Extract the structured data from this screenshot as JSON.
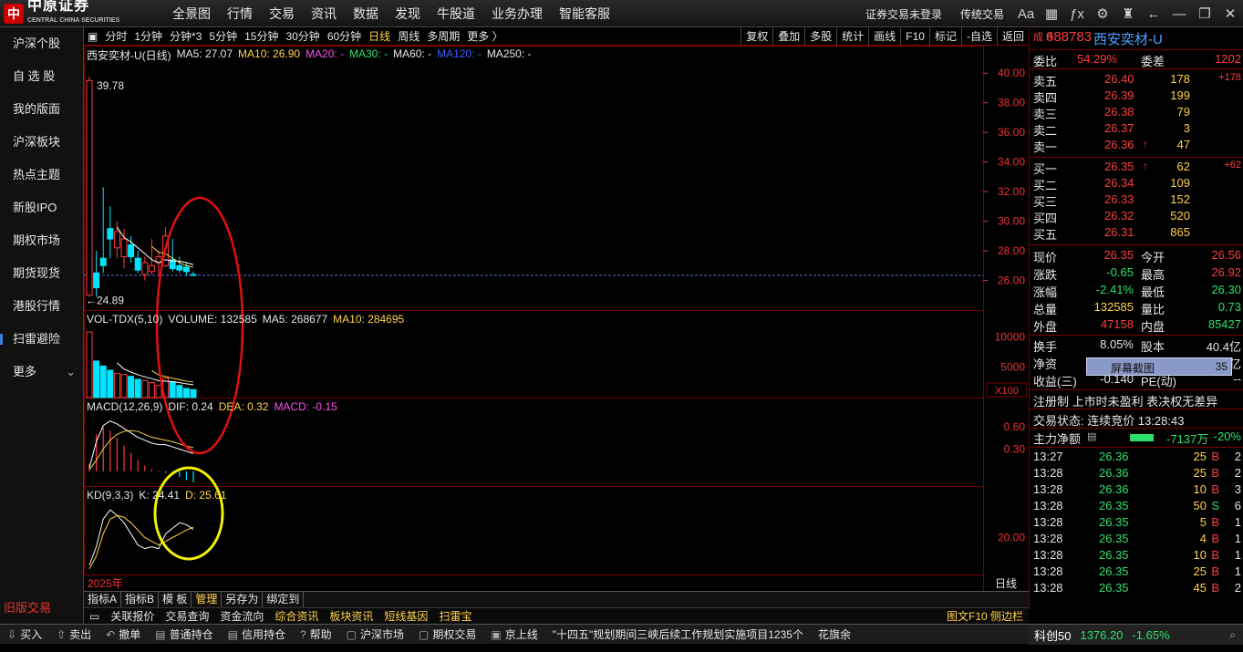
{
  "app": {
    "logo_text": "中原证券",
    "logo_sub": "CENTRAL CHINA SECURITIES",
    "menu": [
      "全景图",
      "行情",
      "交易",
      "资讯",
      "数据",
      "发现",
      "牛股道",
      "业务办理",
      "智能客服"
    ],
    "top_right": [
      "证券交易未登录",
      "传统交易"
    ],
    "top_icons": [
      "font-size-icon",
      "grid-icon",
      "formula-icon",
      "gear-icon",
      "shirt-icon",
      "back-icon",
      "minimize-icon",
      "restore-icon",
      "close-icon"
    ]
  },
  "sidebar": {
    "items": [
      "沪深个股",
      "自 选 股",
      "我的版面",
      "沪深板块",
      "热点主题",
      "新股IPO",
      "期权市场",
      "期货现货",
      "港股行情",
      "扫雷避险",
      "更多"
    ],
    "bottom": "旧版交易"
  },
  "periodbar": {
    "periods": [
      "分时",
      "1分钟",
      "分钟*3",
      "5分钟",
      "15分钟",
      "30分钟",
      "60分钟",
      "日线",
      "周线",
      "多周期",
      "更多 〉"
    ],
    "active": "日线",
    "right": [
      "复权",
      "叠加",
      "多股",
      "统计",
      "画线",
      "F10",
      "标记",
      "-自选",
      "返回"
    ]
  },
  "main_legend": {
    "name": "西安奕材-U(日线)",
    "ma5": "MA5: 27.07",
    "ma10": "MA10: 26.90",
    "ma20": "MA20: -",
    "ma30": "MA30: -",
    "ma60": "MA60: -",
    "ma120": "MA120: -",
    "ma250": "MA250: -",
    "high_label": "39.78",
    "low_label": "24.89"
  },
  "vol_legend": {
    "name": "VOL-TDX(5,10)",
    "volume": "VOLUME: 132585",
    "ma5": "MA5: 268677",
    "ma10": "MA10: 284695",
    "unit": "X100"
  },
  "macd_legend": {
    "name": "MACD(12,26,9)",
    "dif": "DIF: 0.24",
    "dea": "DEA: 0.32",
    "macd": "MACD: -0.15"
  },
  "kd_legend": {
    "name": "KD(9,3,3)",
    "k": "K: 24.41",
    "d": "D: 25.61"
  },
  "year_label": "2025年",
  "axis": {
    "price_ticks": [
      "40.00",
      "38.00",
      "36.00",
      "34.00",
      "32.00",
      "30.00",
      "28.00",
      "26.00"
    ],
    "vol_ticks": [
      "10000",
      "5000"
    ],
    "macd_ticks": [
      "0.60",
      "0.30"
    ],
    "kd_ticks": [
      "20.00"
    ],
    "period_button": "日线"
  },
  "chart_data": {
    "type": "candlestick",
    "price_range": [
      24,
      41
    ],
    "candles": [
      {
        "o": 25.0,
        "h": 39.78,
        "l": 24.89,
        "c": 39.5
      },
      {
        "o": 26.5,
        "h": 28.0,
        "l": 24.89,
        "c": 25.5
      },
      {
        "o": 27.5,
        "h": 32.3,
        "l": 26.5,
        "c": 27.0
      },
      {
        "o": 29.5,
        "h": 31.0,
        "l": 27.5,
        "c": 28.8
      },
      {
        "o": 28.2,
        "h": 30.0,
        "l": 27.5,
        "c": 29.3
      },
      {
        "o": 27.6,
        "h": 29.5,
        "l": 26.8,
        "c": 28.8
      },
      {
        "o": 28.4,
        "h": 29.0,
        "l": 27.2,
        "c": 27.6
      },
      {
        "o": 27.5,
        "h": 28.0,
        "l": 26.5,
        "c": 26.7
      },
      {
        "o": 26.4,
        "h": 27.6,
        "l": 26.0,
        "c": 27.2
      },
      {
        "o": 26.6,
        "h": 28.8,
        "l": 26.4,
        "c": 27.0
      },
      {
        "o": 27.2,
        "h": 28.0,
        "l": 26.3,
        "c": 27.6
      },
      {
        "o": 27.0,
        "h": 29.6,
        "l": 26.9,
        "c": 29.0
      },
      {
        "o": 27.4,
        "h": 28.8,
        "l": 26.6,
        "c": 26.8
      },
      {
        "o": 27.0,
        "h": 27.6,
        "l": 26.5,
        "c": 26.7
      },
      {
        "o": 26.9,
        "h": 27.2,
        "l": 26.3,
        "c": 26.6
      },
      {
        "o": 26.4,
        "h": 26.6,
        "l": 26.3,
        "c": 26.35
      }
    ],
    "volume": [
      10800,
      6000,
      5200,
      4500,
      4000,
      3800,
      3500,
      3000,
      2800,
      2500,
      2000,
      3200,
      2600,
      2000,
      1500,
      1326
    ],
    "macd_hist": [
      0.1,
      0.5,
      0.6,
      0.55,
      0.45,
      0.35,
      0.25,
      0.15,
      0.08,
      0.03,
      0.01,
      -0.02,
      -0.05,
      -0.08,
      -0.12,
      -0.15
    ],
    "dif": [
      0.05,
      0.4,
      0.62,
      0.68,
      0.64,
      0.58,
      0.52,
      0.46,
      0.42,
      0.38,
      0.36,
      0.36,
      0.33,
      0.3,
      0.27,
      0.24
    ],
    "dea": [
      0.02,
      0.15,
      0.3,
      0.42,
      0.5,
      0.54,
      0.55,
      0.54,
      0.5,
      0.46,
      0.44,
      0.42,
      0.4,
      0.37,
      0.34,
      0.32
    ],
    "k": [
      5,
      15,
      30,
      35,
      32,
      28,
      22,
      16,
      14,
      15,
      14,
      22,
      25,
      28,
      27,
      24.41
    ],
    "d": [
      3,
      10,
      22,
      30,
      32,
      31,
      28,
      24,
      20,
      18,
      16,
      18,
      20,
      22,
      24,
      25.61
    ],
    "ma5": [
      null,
      null,
      null,
      null,
      29.6,
      28.9,
      28.6,
      28.2,
      27.8,
      27.4,
      27.2,
      27.4,
      27.3,
      27.3,
      27.2,
      27.07
    ],
    "ma10": [
      null,
      null,
      null,
      null,
      null,
      null,
      null,
      null,
      null,
      28.3,
      27.9,
      27.8,
      27.5,
      27.2,
      27.0,
      26.9
    ],
    "last_price": 26.35
  },
  "quote": {
    "code": "688783",
    "name": "西安奕材-U",
    "badge": "成 R",
    "wb_label": "委比",
    "wb_value": "54.29%",
    "wc_label": "委差",
    "wc_value": "1202",
    "asks": [
      {
        "label": "卖五",
        "price": "26.40",
        "vol": "178",
        "chg": "+178"
      },
      {
        "label": "卖四",
        "price": "26.39",
        "vol": "199",
        "chg": ""
      },
      {
        "label": "卖三",
        "price": "26.38",
        "vol": "79",
        "chg": ""
      },
      {
        "label": "卖二",
        "price": "26.37",
        "vol": "3",
        "chg": ""
      },
      {
        "label": "卖一",
        "price": "26.36",
        "vol": "47",
        "chg": ""
      }
    ],
    "bids": [
      {
        "label": "买一",
        "price": "26.35",
        "vol": "62",
        "chg": "+62"
      },
      {
        "label": "买二",
        "price": "26.34",
        "vol": "109",
        "chg": ""
      },
      {
        "label": "买三",
        "price": "26.33",
        "vol": "152",
        "chg": ""
      },
      {
        "label": "买四",
        "price": "26.32",
        "vol": "520",
        "chg": ""
      },
      {
        "label": "买五",
        "price": "26.31",
        "vol": "865",
        "chg": ""
      }
    ],
    "stats": [
      {
        "l1": "现价",
        "v1": "26.35",
        "l2": "今开",
        "v2": "26.56"
      },
      {
        "l1": "涨跌",
        "v1": "-0.65",
        "l2": "最高",
        "v2": "26.92"
      },
      {
        "l1": "涨幅",
        "v1": "-2.41%",
        "l2": "最低",
        "v2": "26.30"
      },
      {
        "l1": "总量",
        "v1": "132585",
        "l2": "量比",
        "v2": "0.73"
      },
      {
        "l1": "外盘",
        "v1": "47158",
        "l2": "内盘",
        "v2": "85427"
      }
    ],
    "stats2": [
      {
        "l1": "换手",
        "v1": "8.05%",
        "l2": "股本",
        "v2": "40.4亿"
      },
      {
        "l1": "净资",
        "v1": "",
        "l2": "流通",
        "v2": "1.05亿"
      },
      {
        "l1": "收益(三)",
        "v1": "-0.140",
        "l2": "PE(动)",
        "v2": "--"
      }
    ],
    "popup_text": "屏幕截图",
    "popup_num": "35",
    "flags": "注册制 上市时未盈利 表决权无差异",
    "status": "交易状态: 连续竞价 13:28:43",
    "net_label": "主力净额",
    "net_value": "-7137万",
    "net_pct": "-20%",
    "ticks": [
      {
        "t": "13:27",
        "p": "26.36",
        "v": "25",
        "s": "B",
        "n": "2"
      },
      {
        "t": "13:28",
        "p": "26.36",
        "v": "25",
        "s": "B",
        "n": "2"
      },
      {
        "t": "13:28",
        "p": "26.36",
        "v": "10",
        "s": "B",
        "n": "3"
      },
      {
        "t": "13:28",
        "p": "26.35",
        "v": "50",
        "s": "S",
        "n": "6"
      },
      {
        "t": "13:28",
        "p": "26.35",
        "v": "5",
        "s": "B",
        "n": "1"
      },
      {
        "t": "13:28",
        "p": "26.35",
        "v": "4",
        "s": "B",
        "n": "1"
      },
      {
        "t": "13:28",
        "p": "26.35",
        "v": "10",
        "s": "B",
        "n": "1"
      },
      {
        "t": "13:28",
        "p": "26.35",
        "v": "25",
        "s": "B",
        "n": "1"
      },
      {
        "t": "13:28",
        "p": "26.35",
        "v": "45",
        "s": "B",
        "n": "2"
      }
    ]
  },
  "tabs": [
    "指标A",
    "指标B",
    "模 板",
    "管理",
    "另存为",
    "绑定到"
  ],
  "tabs_active": "管理",
  "infobar": [
    "关联报价",
    "交易查询",
    "资金流向",
    "综合资讯",
    "板块资讯",
    "短线基因",
    "扫雷宝"
  ],
  "infobar_right": "图文F10 侧边栏",
  "toolbar": [
    "买入",
    "卖出",
    "撤单",
    "普通持仓",
    "信用持仓",
    "帮助",
    "沪深市场",
    "期权交易",
    "京上线",
    "\"十四五\"规划期间三峡后续工作规划实施项目1235个",
    "花旗余"
  ],
  "index_bar": {
    "name": "科创50",
    "value": "1376.20",
    "chg": "-1.65%"
  }
}
